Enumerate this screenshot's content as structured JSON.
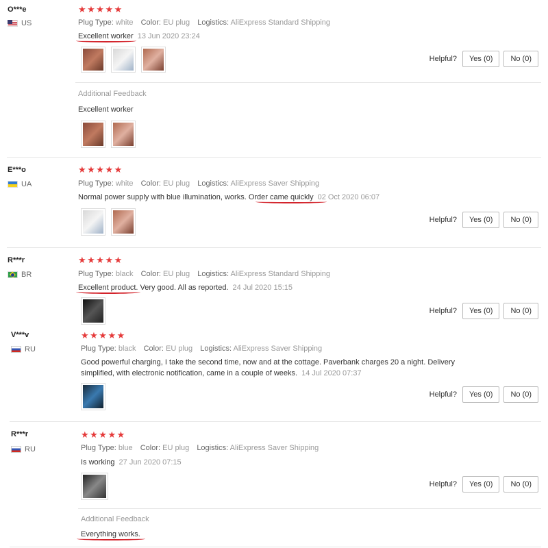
{
  "labels": {
    "plug_type": "Plug Type:",
    "color": "Color:",
    "logistics": "Logistics:",
    "helpful": "Helpful?",
    "additional_feedback": "Additional Feedback"
  },
  "stars": "★★★★★",
  "reviews": [
    {
      "name": "O***e",
      "country": "US",
      "rating": 5,
      "plug_type": "white",
      "color": "EU plug",
      "logistics": "AliExpress Standard Shipping",
      "text": "Excellent worker",
      "date": "13 Jun 2020 23:24",
      "yes": "Yes (0)",
      "no": "No (0)",
      "additional_text": "Excellent worker"
    },
    {
      "name": "E***o",
      "country": "UA",
      "rating": 5,
      "plug_type": "white",
      "color": "EU plug",
      "logistics": "AliExpress Saver Shipping",
      "text": "Normal power supply with blue illumination, works. Order came quickly",
      "date": "02 Oct 2020 06:07",
      "yes": "Yes (0)",
      "no": "No (0)"
    },
    {
      "name": "R***r",
      "country": "BR",
      "rating": 5,
      "plug_type": "black",
      "color": "EU plug",
      "logistics": "AliExpress Standard Shipping",
      "text": "Excellent product. Very good. All as reported.",
      "date": "24 Jul 2020 15:15",
      "yes": "Yes (0)",
      "no": "No (0)"
    },
    {
      "name": "V***v",
      "country": "RU",
      "rating": 5,
      "plug_type": "black",
      "color": "EU plug",
      "logistics": "AliExpress Saver Shipping",
      "text": "Good powerful charging, I take the second time, now and at the cottage. Paverbank charges 20 a night. Delivery simplified, with electronic notification, came in a couple of weeks.",
      "date": "14 Jul 2020 07:37",
      "yes": "Yes (0)",
      "no": "No (0)"
    },
    {
      "name": "R***r",
      "country": "RU",
      "rating": 5,
      "plug_type": "blue",
      "color": "EU plug",
      "logistics": "AliExpress Saver Shipping",
      "text": "Is working",
      "date": "27 Jun 2020 07:15",
      "yes": "Yes (0)",
      "no": "No (0)",
      "additional_text": "Everything works."
    }
  ]
}
